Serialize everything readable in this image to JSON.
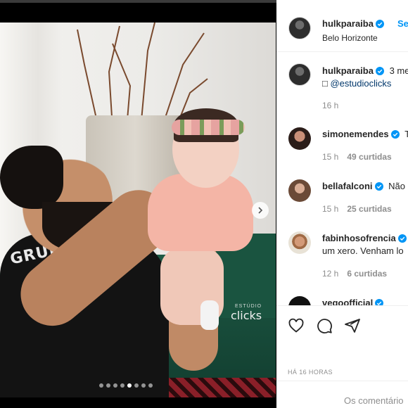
{
  "post": {
    "watermark_small": "ESTÚDIO",
    "watermark_big": "clicks",
    "shirt_text": "GRUDI",
    "carousel": {
      "count": 8,
      "active_index": 4
    }
  },
  "header": {
    "username": "hulkparaiba",
    "follow_label": "Se",
    "location": "Belo Horizonte"
  },
  "comments": [
    {
      "username": "hulkparaiba",
      "text": "3 me",
      "caption_extra": "@estudioclicks",
      "time": "16 h",
      "likes": ""
    },
    {
      "username": "simonemendes",
      "text": "T",
      "time": "15 h",
      "likes": "49 curtidas"
    },
    {
      "username": "bellafalconi",
      "text": "Não",
      "time": "15 h",
      "likes": "25 curtidas"
    },
    {
      "username": "fabinhosofrencia",
      "text": "",
      "line2": "um xero. Venham lo",
      "time": "12 h",
      "likes": "6 curtidas"
    },
    {
      "username": "vegoofficial",
      "text": "",
      "time": "",
      "likes": ""
    }
  ],
  "actions": {
    "time_ago": "HÁ 16 HORAS",
    "add_comment_placeholder": "Os comentário"
  },
  "colors": {
    "verified": "#0095f6",
    "link": "#00376b",
    "muted": "#8e8e8e"
  }
}
